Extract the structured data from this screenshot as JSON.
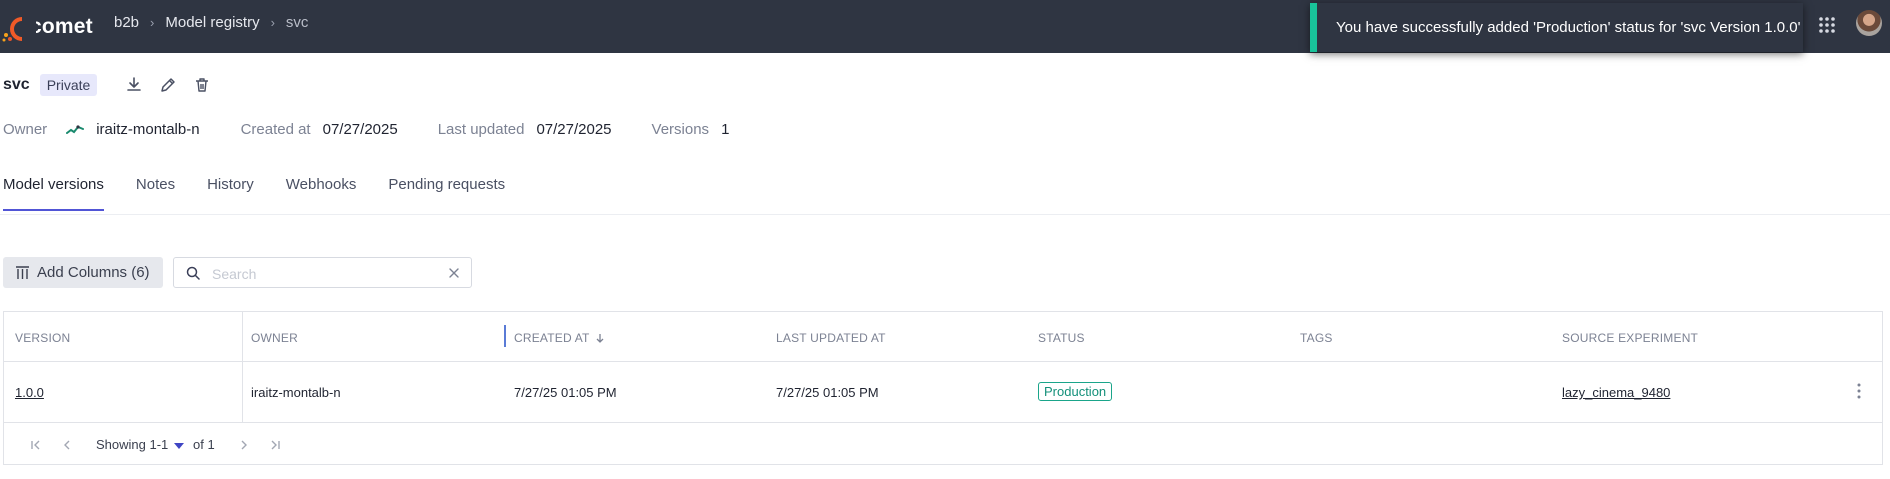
{
  "brand": {
    "name": "comet"
  },
  "breadcrumb": {
    "workspace": "b2b",
    "section": "Model registry",
    "current": "svc"
  },
  "toast": {
    "message": "You have successfully added 'Production' status for 'svc Version 1.0.0'"
  },
  "header": {
    "model_name": "svc",
    "visibility": "Private",
    "owner_label": "Owner",
    "owner": "iraitz-montalb-n",
    "created_label": "Created at",
    "created": "07/27/2025",
    "updated_label": "Last updated",
    "updated": "07/27/2025",
    "versions_label": "Versions",
    "versions": "1"
  },
  "tabs": [
    "Model versions",
    "Notes",
    "History",
    "Webhooks",
    "Pending requests"
  ],
  "toolbar": {
    "add_columns": "Add Columns (6)",
    "search_placeholder": "Search"
  },
  "table": {
    "columns": [
      "VERSION",
      "OWNER",
      "CREATED AT",
      "LAST UPDATED AT",
      "STATUS",
      "TAGS",
      "SOURCE EXPERIMENT"
    ],
    "rows": [
      {
        "version": "1.0.0",
        "owner": "iraitz-montalb-n",
        "created_at": "7/27/25 01:05 PM",
        "updated_at": "7/27/25 01:05 PM",
        "status": "Production",
        "tags": "",
        "source_experiment": "lazy_cinema_9480"
      }
    ]
  },
  "pagination": {
    "showing": "Showing 1-1",
    "of": "of 1"
  },
  "colors": {
    "topbar": "#2f3542",
    "accent": "#5155d6",
    "success": "#19c39a",
    "status": "#1aa58a"
  },
  "icons": [
    "comet-logo",
    "chevron-right-icon",
    "apps-grid-icon",
    "avatar",
    "download-icon",
    "edit-icon",
    "delete-icon",
    "owner-avatar-icon",
    "columns-icon",
    "search-icon",
    "close-icon",
    "sort-down-icon",
    "more-vertical-icon",
    "first-page-icon",
    "prev-page-icon",
    "caret-down-icon",
    "next-page-icon",
    "last-page-icon"
  ]
}
